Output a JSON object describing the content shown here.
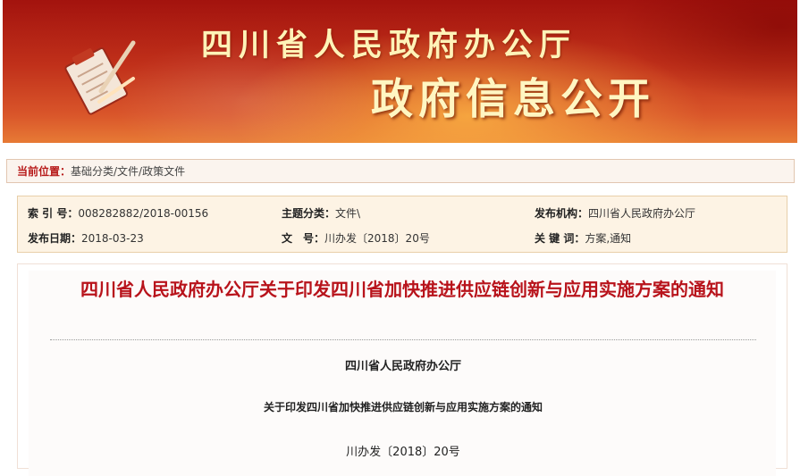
{
  "banner": {
    "title_top": "四川省人民政府办公厅",
    "title_main": "政府信息公开"
  },
  "breadcrumb": {
    "label": "当前位置：",
    "path": "基础分类/文件/政策文件"
  },
  "info": {
    "index_label": "索 引 号：",
    "index_value": "008282882/2018-00156",
    "category_label": "主题分类：",
    "category_value": "文件\\",
    "publisher_label": "发布机构：",
    "publisher_value": "四川省人民政府办公厅",
    "date_label": "发布日期：",
    "date_value": "2018-03-23",
    "docno_label": "文　号：",
    "docno_value": "川办发〔2018〕20号",
    "keywords_label": "关 键 词：",
    "keywords_value": "方案,通知"
  },
  "document": {
    "title": "四川省人民政府办公厅关于印发四川省加快推进供应链创新与应用实施方案的通知",
    "issuer": "四川省人民政府办公厅",
    "subtitle": "关于印发四川省加快推进供应链创新与应用实施方案的通知",
    "doc_number": "川办发〔2018〕20号"
  },
  "colors": {
    "banner_red": "#b01c12",
    "accent_red": "#b8131b",
    "info_bg": "#fdf3e4"
  }
}
